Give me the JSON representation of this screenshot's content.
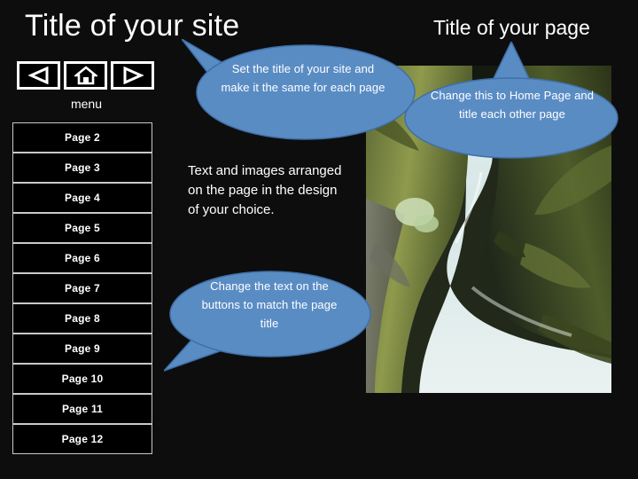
{
  "theme": {
    "background": "#0d0d0d",
    "text": "#ffffff",
    "bubble_fill": "#5a8cc4",
    "bubble_stroke": "#3f6fa8",
    "button_border": "#c9c9c9",
    "button_fill": "#000000"
  },
  "header": {
    "site_title": "Title of your site",
    "page_title": "Title of your page"
  },
  "nav": {
    "menu_label": "menu",
    "buttons": [
      {
        "name": "back-button",
        "icon": "triangle-left-icon"
      },
      {
        "name": "home-button",
        "icon": "home-icon"
      },
      {
        "name": "forward-button",
        "icon": "triangle-right-icon"
      }
    ]
  },
  "pages": [
    {
      "label": "Page 2"
    },
    {
      "label": "Page 3"
    },
    {
      "label": "Page 4"
    },
    {
      "label": "Page 5"
    },
    {
      "label": "Page 6"
    },
    {
      "label": "Page 7"
    },
    {
      "label": "Page 8"
    },
    {
      "label": "Page 9"
    },
    {
      "label": "Page 10"
    },
    {
      "label": "Page 11"
    },
    {
      "label": "Page 12"
    }
  ],
  "main": {
    "body_text": "Text and images arranged on the page in the design of your choice."
  },
  "callouts": {
    "title_bubble": "Set the title of your site and make it the same for each page",
    "page_bubble": "Change this to Home Page and title each other page",
    "buttons_bubble": "Change the text on the buttons to match the page title"
  },
  "photo": {
    "alt": "Pale blue river flowing through a mossy rocky gorge"
  }
}
